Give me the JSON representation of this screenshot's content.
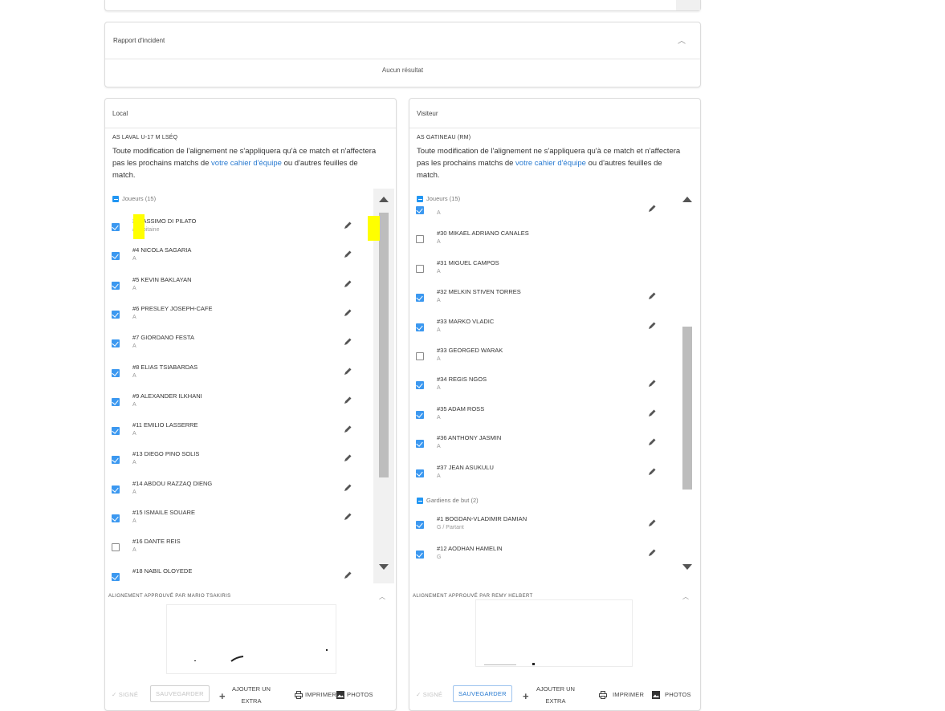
{
  "incident": {
    "title": "Rapport d'incident",
    "no_result": "Aucun résultat"
  },
  "local": {
    "header": "Local",
    "team": "AS LAVAL U-17 M LSÉQ",
    "notice_before": "Toute modification de l'alignement ne s'appliquera qu'à ce match et n'affectera pas les prochains matchs de ",
    "notice_link": "votre cahier d'équipe",
    "notice_after": " ou d'autres feuilles de match.",
    "group_players": "Joueurs (15)",
    "players": [
      {
        "name": "3 MASSIMO DI PILATO",
        "role": "/ Capitaine",
        "checked": true
      },
      {
        "name": "#4 NICOLA SAGARIA",
        "role": "A",
        "checked": true
      },
      {
        "name": "#5 KEVIN BAKLAYAN",
        "role": "A",
        "checked": true
      },
      {
        "name": "#6 PRESLEY JOSEPH-CAFE",
        "role": "A",
        "checked": true
      },
      {
        "name": "#7 GIORDANO FESTA",
        "role": "A",
        "checked": true
      },
      {
        "name": "#8 ELIAS TSIABARDAS",
        "role": "A",
        "checked": true
      },
      {
        "name": "#9 ALEXANDER ILKHANI",
        "role": "A",
        "checked": true
      },
      {
        "name": "#11 EMILIO LASSERRE",
        "role": "A",
        "checked": true
      },
      {
        "name": "#13 DIEGO PINO SOLIS",
        "role": "A",
        "checked": true
      },
      {
        "name": "#14 ABDOU RAZZAQ DIENG",
        "role": "A",
        "checked": true
      },
      {
        "name": "#15 ISMAILE SOUARE",
        "role": "A",
        "checked": true
      },
      {
        "name": "#16 DANTE REIS",
        "role": "A",
        "checked": false
      },
      {
        "name": "#18 NABIL OLOYEDE",
        "role": "",
        "checked": true
      }
    ],
    "approved": "ALIGNEMENT APPROUVÉ PAR MARIO TSAKIRIS",
    "signed": "SIGNÉ",
    "save": "SAUVEGARDER",
    "add_extra_1": "AJOUTER UN",
    "add_extra_2": "EXTRA",
    "print": "IMPRIMER",
    "photos": "PHOTOS"
  },
  "visitor": {
    "header": "Visiteur",
    "team": "AS GATINEAU (RM)",
    "notice_before": "Toute modification de l'alignement ne s'appliquera qu'à ce match et n'affectera pas les prochains matchs de ",
    "notice_link": "votre cahier d'équipe",
    "notice_after": " ou d'autres feuilles de match.",
    "group_players": "Joueurs (15)",
    "players": [
      {
        "name": "",
        "role": "A",
        "checked": true
      },
      {
        "name": "#30 MIKAEL ADRIANO CANALES",
        "role": "A",
        "checked": false
      },
      {
        "name": "#31 MIGUEL CAMPOS",
        "role": "A",
        "checked": false
      },
      {
        "name": "#32 MELKIN STIVEN TORRES",
        "role": "A",
        "checked": true
      },
      {
        "name": "#33 MARKO VLADIC",
        "role": "A",
        "checked": true
      },
      {
        "name": "#33 GEORGED WARAK",
        "role": "A",
        "checked": false
      },
      {
        "name": "#34 REGIS NGOS",
        "role": "A",
        "checked": true
      },
      {
        "name": "#35 ADAM ROSS",
        "role": "A",
        "checked": true
      },
      {
        "name": "#36 ANTHONY JASMIN",
        "role": "A",
        "checked": true
      },
      {
        "name": "#37 JEAN ASUKULU",
        "role": "A",
        "checked": true
      }
    ],
    "group_keepers": "Gardiens de but (2)",
    "keepers": [
      {
        "name": "#1 BOGDAN-VLADIMIR DAMIAN",
        "role": "G / Partant",
        "checked": true
      },
      {
        "name": "#12 AODHAN HAMELIN",
        "role": "G",
        "checked": true
      }
    ],
    "approved": "ALIGNEMENT APPROUVÉ PAR REMY HELBERT",
    "signed": "SIGNÉ",
    "save": "SAUVEGARDER",
    "add_extra_1": "AJOUTER UN",
    "add_extra_2": "EXTRA",
    "print": "IMPRIMER",
    "photos": "PHOTOS"
  },
  "colors": {
    "accent": "#2196f3",
    "highlight": "#ffff00"
  }
}
